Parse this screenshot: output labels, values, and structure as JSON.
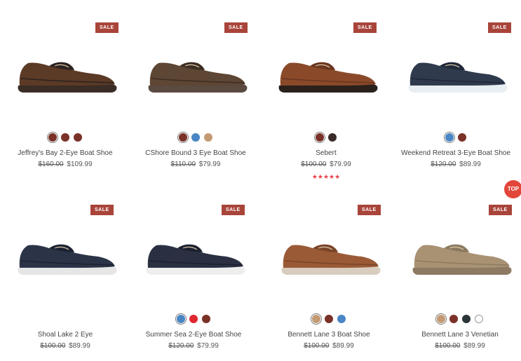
{
  "products": [
    {
      "badge": "SALE",
      "name": "Jeffrey's Bay 2-Eye Boat Shoe",
      "original_price": "$160.00",
      "sale_price": "$109.99",
      "swatches": [
        "#7a3128",
        "#7a3128",
        "#7a3128"
      ],
      "shoe_colors": {
        "upper": "#5b3a26",
        "dark": "#2b2220",
        "sole": "#3a2d25"
      }
    },
    {
      "badge": "SALE",
      "name": "CShore Bound 3 Eye Boat Shoe",
      "original_price": "$110.00",
      "sale_price": "$79.99",
      "swatches": [
        "#7a3128",
        "#4a86c5",
        "#c49a74"
      ],
      "shoe_colors": {
        "upper": "#5e4634",
        "dark": "#3d2c22",
        "sole": "#5a4a40"
      }
    },
    {
      "badge": "SALE",
      "name": "Sebert",
      "original_price": "$100.00",
      "sale_price": "$79.99",
      "rating": "★★★★★",
      "swatches": [
        "#7a3128",
        "#3a2b28"
      ],
      "shoe_colors": {
        "upper": "#8a4a2a",
        "dark": "#6b3520",
        "sole": "#2a201c"
      }
    },
    {
      "badge": "SALE",
      "name": "Weekend Retreat 3-Eye Boat Shoe",
      "original_price": "$120.00",
      "sale_price": "$89.99",
      "swatches": [
        "#4a86c5",
        "#7a3128"
      ],
      "shoe_colors": {
        "upper": "#2f3a4d",
        "dark": "#1f2738",
        "sole": "#e8eef2"
      }
    },
    {
      "badge": "SALE",
      "name": "Shoal Lake 2 Eye",
      "original_price": "$100.00",
      "sale_price": "$89.99",
      "swatches": [],
      "shoe_colors": {
        "upper": "#2b3447",
        "dark": "#1c2232",
        "sole": "#e6e6e6"
      }
    },
    {
      "badge": "SALE",
      "name": "Summer Sea 2-Eye Boat Shoe",
      "original_price": "$120.00",
      "sale_price": "$79.99",
      "swatches": [
        "#4a86c5",
        "#e0272f",
        "#7a3128"
      ],
      "shoe_colors": {
        "upper": "#2a3042",
        "dark": "#1c2030",
        "sole": "#eeeeee"
      }
    },
    {
      "badge": "SALE",
      "name": "Bennett Lane 3 Boat Shoe",
      "original_price": "$100.00",
      "sale_price": "$89.99",
      "swatches": [
        "#c49a74",
        "#7a3128",
        "#4a86c5"
      ],
      "shoe_colors": {
        "upper": "#9a5a36",
        "dark": "#7a4428",
        "sole": "#d8cdbf"
      }
    },
    {
      "badge": "SALE",
      "name": "Bennett Lane 3 Venetian",
      "original_price": "$100.00",
      "sale_price": "$89.99",
      "swatches": [
        "#c49a74",
        "#7a3128",
        "#2b3537",
        "#ffffff"
      ],
      "shoe_colors": {
        "upper": "#a99274",
        "dark": "#8c7a60",
        "sole": "#8e7a62"
      }
    }
  ],
  "scroll_top_label": "TOP"
}
